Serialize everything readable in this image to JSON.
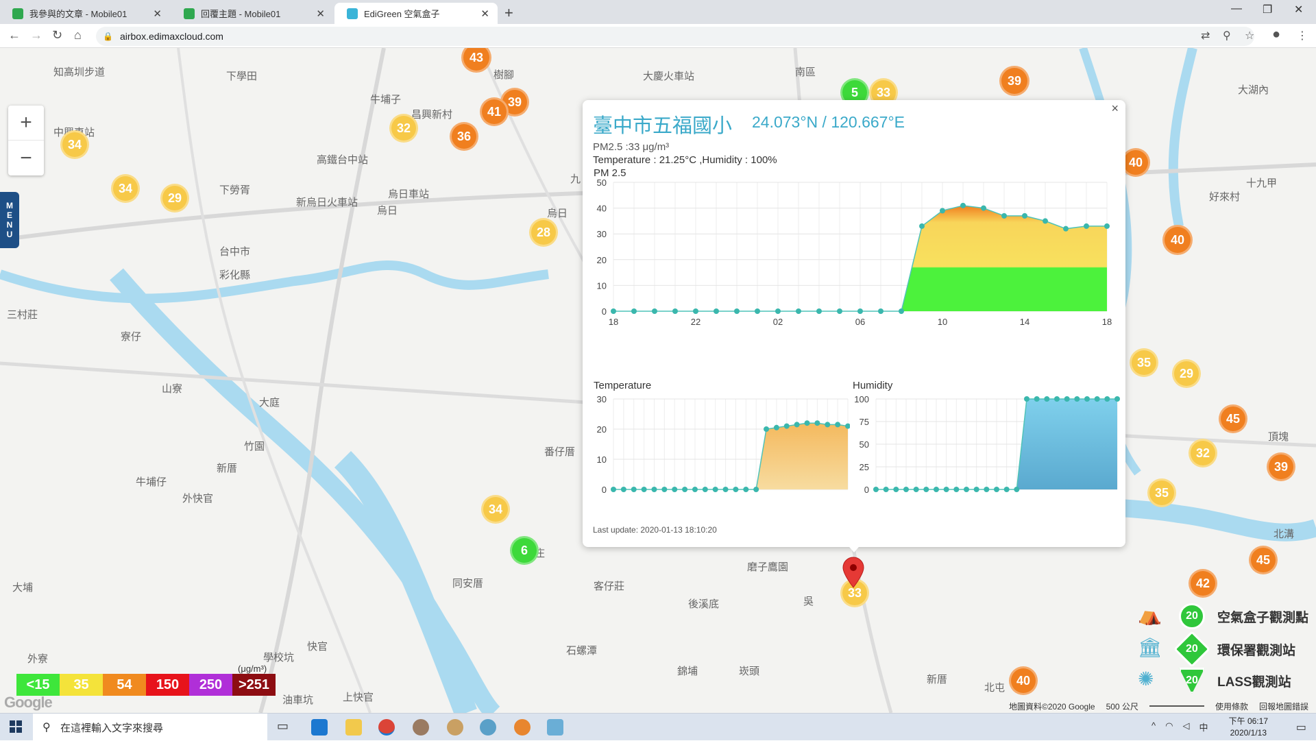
{
  "browser": {
    "tabs": [
      {
        "title": "我參與的文章 - Mobile01",
        "active": false
      },
      {
        "title": "回覆主題 - Mobile01",
        "active": false
      },
      {
        "title": "EdiGreen 空氣盒子",
        "active": true
      }
    ],
    "url": "airbox.edimaxcloud.com"
  },
  "map": {
    "place_labels": [
      "知高圳步道",
      "下學田",
      "牛埔子",
      "昌興新村",
      "樹腳",
      "大慶火車站",
      "南區",
      "大湖內",
      "中興車站",
      "高鐵台中站",
      "新烏日火車站",
      "烏日",
      "烏日車站",
      "下勞胥",
      "台中市",
      "彩化縣",
      "三村莊",
      "寮仔",
      "山寮",
      "大庭",
      "竹園",
      "新厝",
      "牛埔仔",
      "外快官",
      "大埔",
      "同安厝",
      "照和庄",
      "客仔莊",
      "磨子鷹園",
      "後溪底",
      "快官",
      "學校坑",
      "上快官",
      "油車坑",
      "外寮",
      "石螺潭",
      "錦埔",
      "崁頭",
      "新厝",
      "北屯",
      "好來村",
      "十九甲",
      "頂塊",
      "北溝",
      "番仔厝",
      "烏日",
      "九",
      "吳"
    ],
    "markers": [
      {
        "value": "43",
        "color": "orange"
      },
      {
        "value": "39",
        "color": "orange"
      },
      {
        "value": "41",
        "color": "orange"
      },
      {
        "value": "32",
        "color": "yellow"
      },
      {
        "value": "36",
        "color": "orange"
      },
      {
        "value": "34",
        "color": "yellow"
      },
      {
        "value": "34",
        "color": "yellow"
      },
      {
        "value": "29",
        "color": "yellow"
      },
      {
        "value": "28",
        "color": "yellow"
      },
      {
        "value": "5",
        "color": "green"
      },
      {
        "value": "33",
        "color": "yellow"
      },
      {
        "value": "39",
        "color": "orange"
      },
      {
        "value": "40",
        "color": "orange"
      },
      {
        "value": "40",
        "color": "orange"
      },
      {
        "value": "35",
        "color": "yellow"
      },
      {
        "value": "29",
        "color": "yellow"
      },
      {
        "value": "45",
        "color": "orange"
      },
      {
        "value": "32",
        "color": "yellow"
      },
      {
        "value": "39",
        "color": "orange"
      },
      {
        "value": "35",
        "color": "yellow"
      },
      {
        "value": "45",
        "color": "orange"
      },
      {
        "value": "42",
        "color": "orange"
      },
      {
        "value": "34",
        "color": "yellow"
      },
      {
        "value": "6",
        "color": "green"
      },
      {
        "value": "40",
        "color": "orange"
      },
      {
        "value": "33",
        "color": "yellow"
      }
    ],
    "zoom_in": "+",
    "zoom_out": "−",
    "menu_label": [
      "M",
      "E",
      "N",
      "U"
    ]
  },
  "popup": {
    "station_name": "臺中市五福國小",
    "coordinates": "24.073°N / 120.667°E",
    "pm25_line": "PM2.5 :33 μg/m³",
    "temp_line": "Temperature : 21.25°C ,Humidity : 100%",
    "pm_chart_title": "PM 2.5",
    "temp_chart_title": "Temperature",
    "hum_chart_title": "Humidity",
    "last_update": "Last update: 2020-01-13 18:10:20",
    "close": "×"
  },
  "chart_data": [
    {
      "type": "area",
      "title": "PM 2.5",
      "ylim": [
        0,
        50
      ],
      "y_ticks": [
        "0",
        "10",
        "20",
        "30",
        "40",
        "50"
      ],
      "x_ticks": [
        "18",
        "22",
        "02",
        "06",
        "10",
        "14",
        "18"
      ],
      "values": [
        0,
        0,
        0,
        0,
        0,
        0,
        0,
        0,
        0,
        0,
        0,
        0,
        0,
        0,
        0,
        33,
        39,
        41,
        40,
        37,
        37,
        35,
        32,
        33,
        33
      ]
    },
    {
      "type": "area",
      "title": "Temperature",
      "ylim": [
        0,
        30
      ],
      "y_ticks": [
        "0",
        "10",
        "20",
        "30"
      ],
      "values": [
        0,
        0,
        0,
        0,
        0,
        0,
        0,
        0,
        0,
        0,
        0,
        0,
        0,
        0,
        0,
        20,
        20.5,
        21,
        21.5,
        22,
        22,
        21.5,
        21.5,
        21
      ]
    },
    {
      "type": "area",
      "title": "Humidity",
      "ylim": [
        0,
        100
      ],
      "y_ticks": [
        "0",
        "25",
        "50",
        "75",
        "100"
      ],
      "values": [
        0,
        0,
        0,
        0,
        0,
        0,
        0,
        0,
        0,
        0,
        0,
        0,
        0,
        0,
        0,
        100,
        100,
        100,
        100,
        100,
        100,
        100,
        100,
        100,
        100
      ]
    }
  ],
  "aqi_legend": {
    "unit": "(μg/m³)",
    "levels": [
      {
        "label": "<15",
        "color": "#3ee63b"
      },
      {
        "label": "35",
        "color": "#f4e33a"
      },
      {
        "label": "54",
        "color": "#f08a1f"
      },
      {
        "label": "150",
        "color": "#e7131b"
      },
      {
        "label": "250",
        "color": "#b02fd8"
      },
      {
        "label": ">251",
        "color": "#8d0d12"
      }
    ]
  },
  "station_legend": [
    {
      "badge": "20",
      "label": "空氣盒子觀測點"
    },
    {
      "badge": "20",
      "label": "環保署觀測站"
    },
    {
      "badge": "20",
      "label": "LASS觀測站"
    }
  ],
  "map_footer": {
    "attribution": "地圖資料©2020 Google",
    "scale": "500 公尺",
    "terms": "使用條款",
    "report": "回報地圖錯誤"
  },
  "google_logo": "Google",
  "taskbar": {
    "search_placeholder": "在這裡輸入文字來搜尋",
    "time": "下午 06:17",
    "date": "2020/1/13",
    "ime": "中"
  }
}
